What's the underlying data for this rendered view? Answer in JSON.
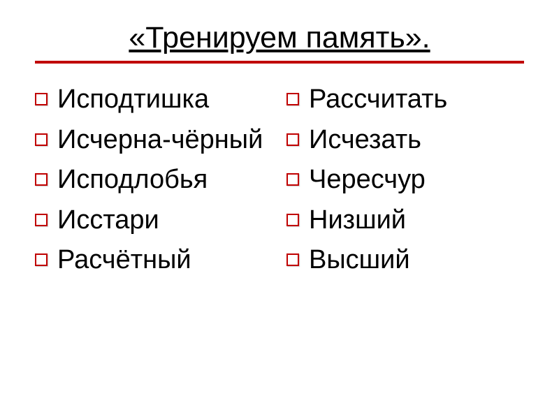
{
  "title": "«Тренируем память».",
  "columns": {
    "left": [
      "Исподтишка",
      "Исчерна-чёрный",
      "Исподлобья",
      "Исстари",
      "Расчётный"
    ],
    "right": [
      "Рассчитать",
      "Исчезать",
      "Чересчур",
      "Низший",
      "Высший"
    ]
  },
  "colors": {
    "accent": "#c00000",
    "text": "#000000",
    "background": "#ffffff"
  }
}
